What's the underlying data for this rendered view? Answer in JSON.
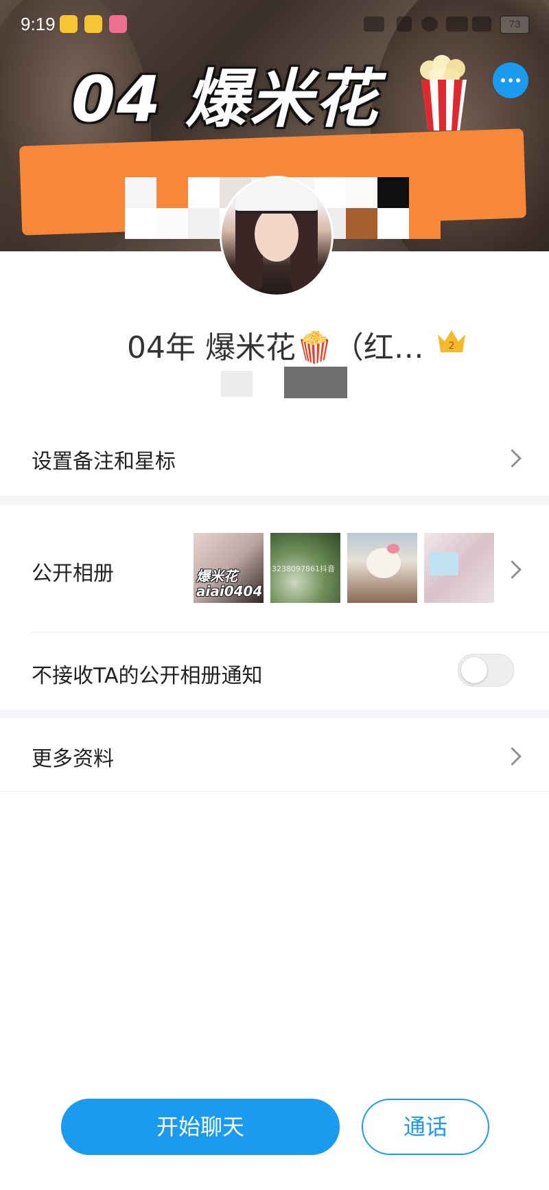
{
  "status_bar": {
    "time": "9:19",
    "battery": "73"
  },
  "banner": {
    "title": "04 爆米花"
  },
  "profile": {
    "name": "04年 爆米花🍿（红…",
    "crown_level": "2"
  },
  "rows": {
    "remark": "设置备注和星标",
    "album": "公开相册",
    "album_notice": "不接收TA的公开相册通知",
    "more": "更多资料"
  },
  "album_thumbs": [
    {
      "caption_line1": "爆米花",
      "caption_line2": "aiai0404"
    },
    {
      "watermark": "3238097861抖音"
    },
    {
      "caption": ""
    },
    {
      "caption": ""
    }
  ],
  "toggle": {
    "album_notice_on": false
  },
  "actions": {
    "chat": "开始聊天",
    "call": "通话"
  },
  "colors": {
    "accent": "#1a9bf0",
    "banner_band": "#f7883a"
  }
}
